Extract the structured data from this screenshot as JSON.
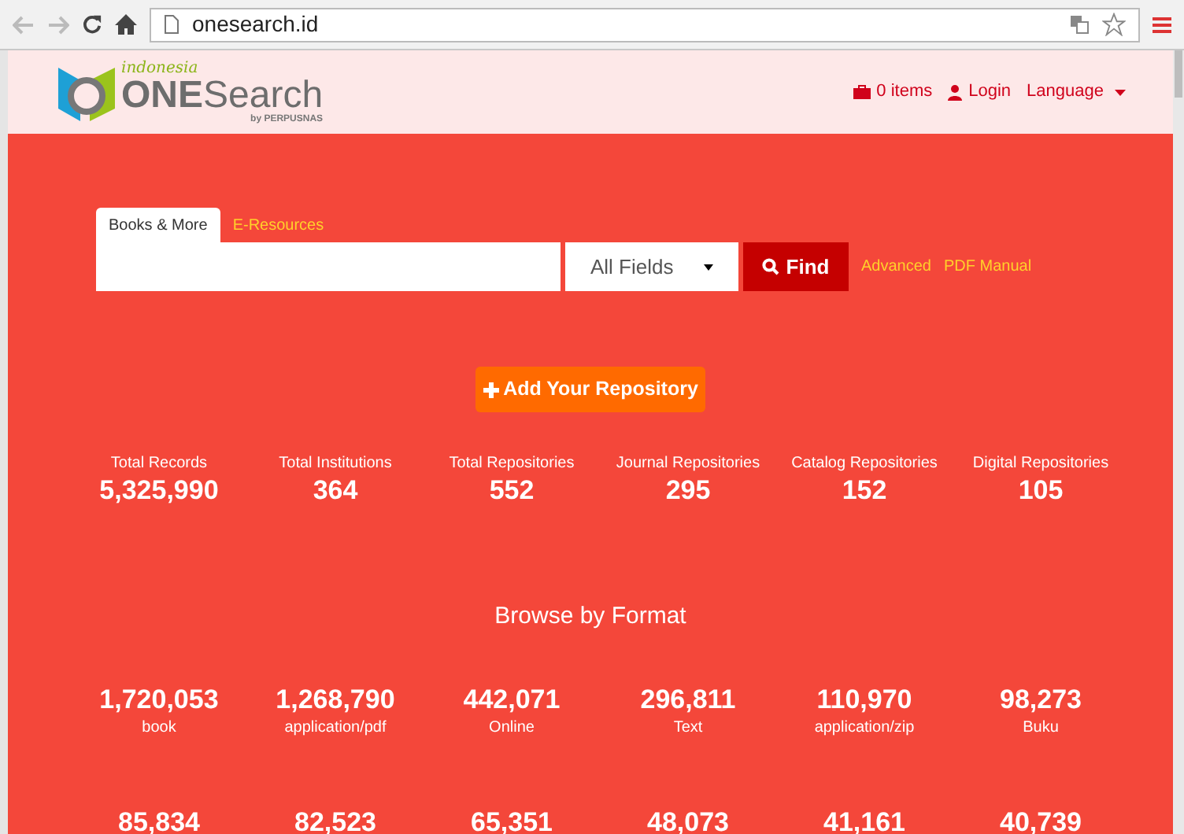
{
  "browser": {
    "url": "onesearch.id"
  },
  "logo": {
    "top": "indonesia",
    "main_left": "ONE",
    "main_right": "Search",
    "sub": "by PERPUSNAS"
  },
  "nav": [
    {
      "kind": "cart",
      "label": "0 items"
    },
    {
      "kind": "login",
      "label": "Login"
    },
    {
      "kind": "language",
      "label": "Language"
    }
  ],
  "search": {
    "tabs": [
      {
        "label": "Books & More",
        "selected": true
      },
      {
        "label": "E-Resources",
        "selected": false
      }
    ],
    "field_select": "All Fields",
    "find_button": "Find",
    "links": [
      "Advanced",
      "PDF Manual"
    ]
  },
  "add_repository_button": "Add Your Repository",
  "stats": [
    {
      "label": "Total Records",
      "value": "5,325,990"
    },
    {
      "label": "Total Institutions",
      "value": "364"
    },
    {
      "label": "Total Repositories",
      "value": "552"
    },
    {
      "label": "Journal Repositories",
      "value": "295"
    },
    {
      "label": "Catalog Repositories",
      "value": "152"
    },
    {
      "label": "Digital Repositories",
      "value": "105"
    }
  ],
  "browse_title": "Browse by Format",
  "formats": [
    {
      "value": "1,720,053",
      "label": "book"
    },
    {
      "value": "1,268,790",
      "label": "application/pdf"
    },
    {
      "value": "442,071",
      "label": "Online"
    },
    {
      "value": "296,811",
      "label": "Text"
    },
    {
      "value": "110,970",
      "label": "application/zip"
    },
    {
      "value": "98,273",
      "label": "Buku"
    },
    {
      "value": "85,834"
    },
    {
      "value": "82,523"
    },
    {
      "value": "65,351"
    },
    {
      "value": "48,073"
    },
    {
      "value": "41,161"
    },
    {
      "value": "40,739"
    }
  ]
}
